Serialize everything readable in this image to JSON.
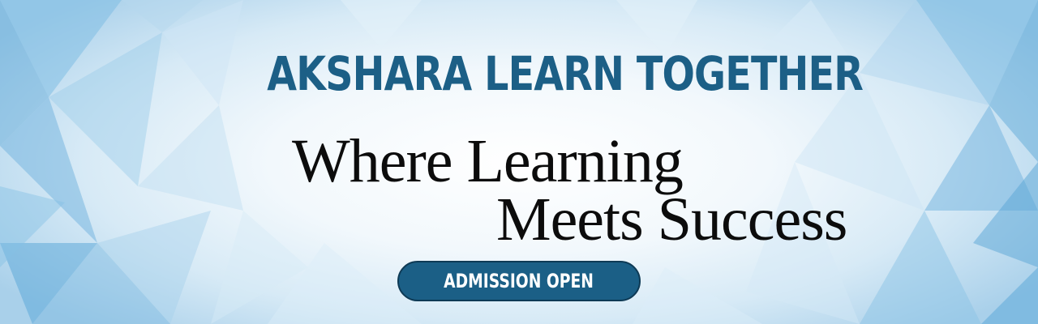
{
  "banner": {
    "headline": "AKSHARA LEARN TOGETHER",
    "tagline_line1": "Where Learning",
    "tagline_line2": "Meets Success",
    "cta_label": "ADMISSION OPEN"
  },
  "colors": {
    "headline": "#1c5f86",
    "tagline": "#0c0c0c",
    "cta_background": "#1b5f86",
    "cta_text": "#ffffff",
    "background_light": "#f2f8fc",
    "background_accent": "#5fa9d8"
  }
}
